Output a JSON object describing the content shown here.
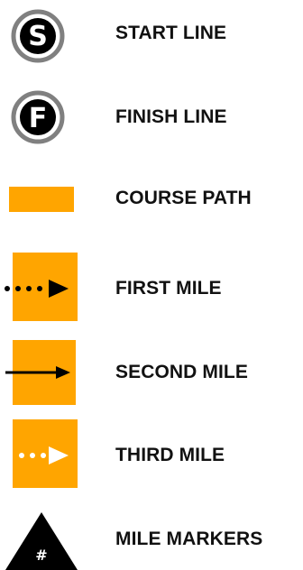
{
  "legend": {
    "items": [
      {
        "id": "start",
        "label": "START LINE",
        "icon": "start-circle-icon",
        "glyph": "S"
      },
      {
        "id": "finish",
        "label": "FINISH LINE",
        "icon": "finish-circle-icon",
        "glyph": "F"
      },
      {
        "id": "course",
        "label": "COURSE PATH",
        "icon": "course-path-swatch"
      },
      {
        "id": "first",
        "label": "FIRST MILE",
        "icon": "dotted-arrow-icon"
      },
      {
        "id": "second",
        "label": "SECOND MILE",
        "icon": "solid-arrow-icon"
      },
      {
        "id": "third",
        "label": "THIRD MILE",
        "icon": "white-dotted-arrow-icon"
      },
      {
        "id": "markers",
        "label": "MILE MARKERS",
        "icon": "mile-marker-triangle-icon",
        "glyph": "#"
      }
    ]
  },
  "colors": {
    "course": "#FFA500",
    "ring": "#808080",
    "ink": "#000000",
    "text": "#111111"
  }
}
